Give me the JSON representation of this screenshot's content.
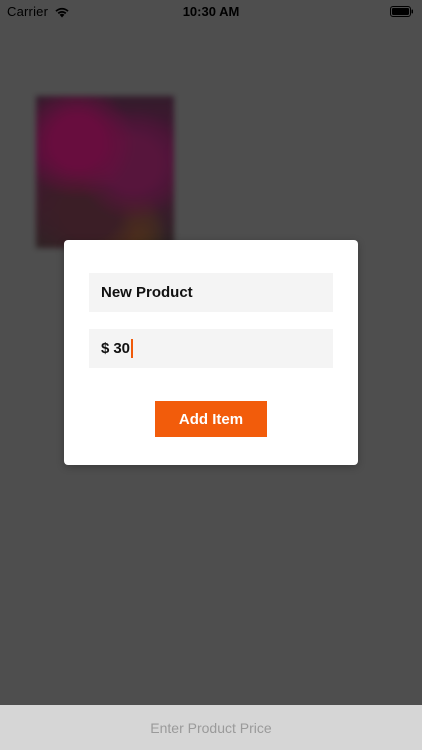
{
  "status_bar": {
    "carrier": "Carrier",
    "time": "10:30 AM",
    "wifi_icon": "wifi-icon",
    "battery_icon": "battery-icon"
  },
  "modal": {
    "product_name_value": "New Product",
    "price_currency": "$",
    "price_value": "30",
    "add_button_label": "Add Item"
  },
  "bottom_bar": {
    "label": "Enter Product Price"
  },
  "colors": {
    "accent": "#f25c0b",
    "overlay": "#4e4e4e",
    "field_bg": "#f4f4f4"
  }
}
